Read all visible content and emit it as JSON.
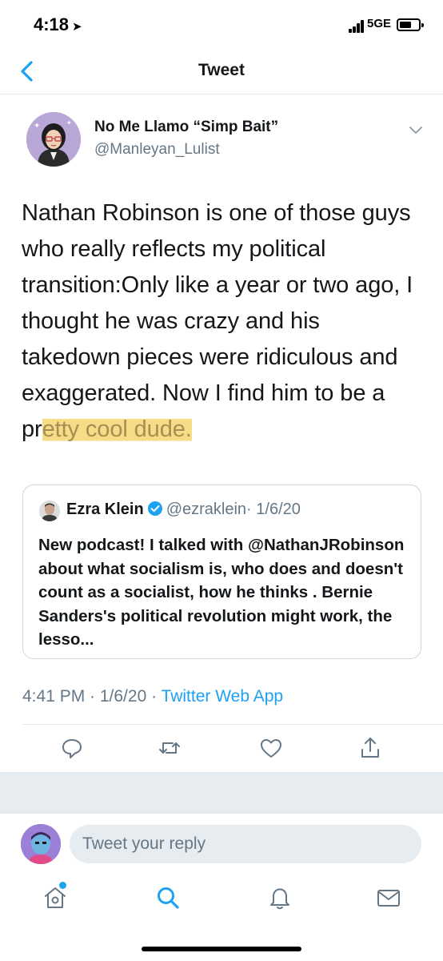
{
  "status_bar": {
    "time": "4:18",
    "location_icon": "location-arrow-icon",
    "network": "5GE",
    "battery_level": 0.45
  },
  "header": {
    "title": "Tweet",
    "back_icon": "chevron-left-icon"
  },
  "tweet": {
    "author_name": "No Me Llamo “Simp Bait”",
    "author_handle": "@Manleyan_Lulist",
    "text_before_highlight": "Nathan Robinson is one of those guys who really reflects my political transition:Only like a year or two ago, I thought he was crazy and his takedown pieces were ridiculous and exaggerated. Now I find him to be a pr",
    "text_highlighted": "etty cool dude.",
    "highlight_color": "#f6dc86",
    "timestamp": "4:41 PM · 1/6/20 · ",
    "source": "Twitter Web App"
  },
  "quoted_tweet": {
    "author_name": "Ezra Klein",
    "verified": true,
    "author_handle": "@ezraklein",
    "date": "· 1/6/20",
    "text": "New podcast! I talked with @NathanJRobinson about what socialism is, who does and doesn't count as a socialist, how he thinks . Bernie Sanders's political revolution might work, the lesso..."
  },
  "actions": [
    {
      "name": "reply",
      "icon": "comment-icon"
    },
    {
      "name": "retweet",
      "icon": "retweet-icon"
    },
    {
      "name": "like",
      "icon": "heart-icon"
    },
    {
      "name": "share",
      "icon": "share-icon"
    }
  ],
  "reply_bar": {
    "placeholder": "Tweet your reply"
  },
  "tab_bar": [
    {
      "name": "home",
      "icon": "home-icon",
      "has_notification_dot": true
    },
    {
      "name": "search",
      "icon": "search-icon",
      "active": true
    },
    {
      "name": "notifications",
      "icon": "bell-icon"
    },
    {
      "name": "messages",
      "icon": "mail-icon"
    }
  ],
  "colors": {
    "accent": "#1da1f2",
    "text": "#14171a",
    "secondary_text": "#657786",
    "border": "#e1e8ed"
  }
}
